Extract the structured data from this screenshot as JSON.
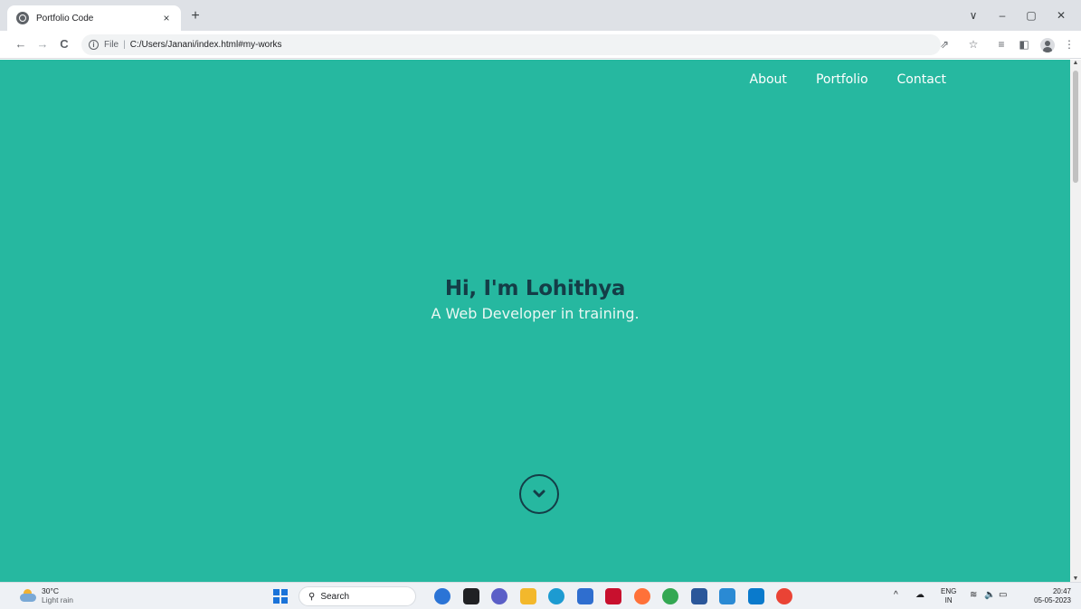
{
  "browser": {
    "tab_title": "Portfolio Code",
    "tab_close": "×",
    "new_tab": "+",
    "address_scheme": "File",
    "address_separator": "|",
    "address_url": "C:/Users/Janani/index.html#my-works",
    "nav_back": "←",
    "nav_forward": "→",
    "nav_reload": "C",
    "window_controls": {
      "collapse": "∨",
      "minimize": "–",
      "restore": "▢",
      "close": "✕"
    },
    "toolbar_icons": {
      "share": "⇗",
      "bookmark": "☆",
      "reading_list": "≡",
      "side_panel": "◧",
      "menu": "⋮"
    }
  },
  "site": {
    "nav": [
      "About",
      "Portfolio",
      "Contact"
    ],
    "heading": "Hi, I'm Lohithya",
    "subheading": "A Web Developer in training.",
    "background_color": "#26b8a0",
    "heading_color": "#143d47"
  },
  "taskbar": {
    "weather_temp": "30°C",
    "weather_condition": "Light rain",
    "search_placeholder": "Search",
    "apps": [
      {
        "name": "bing-chat",
        "color": "#2b74d6"
      },
      {
        "name": "task-view",
        "color": "#202124"
      },
      {
        "name": "teams",
        "color": "#5b5fc7"
      },
      {
        "name": "file-explorer",
        "color": "#f3b82c"
      },
      {
        "name": "edge",
        "color": "#1d9bd1"
      },
      {
        "name": "store",
        "color": "#2f6ecf"
      },
      {
        "name": "mcafee",
        "color": "#c8102e"
      },
      {
        "name": "firefox",
        "color": "#ff7139"
      },
      {
        "name": "chrome",
        "color": "#34a853"
      },
      {
        "name": "word",
        "color": "#2b579a"
      },
      {
        "name": "photos",
        "color": "#2a8ad4"
      },
      {
        "name": "vscode",
        "color": "#0a7acc"
      },
      {
        "name": "chrome-alt",
        "color": "#ea4335"
      }
    ],
    "tray_lang_top": "ENG",
    "tray_lang_bottom": "IN",
    "clock_time": "20:47",
    "clock_date": "05-05-2023"
  }
}
